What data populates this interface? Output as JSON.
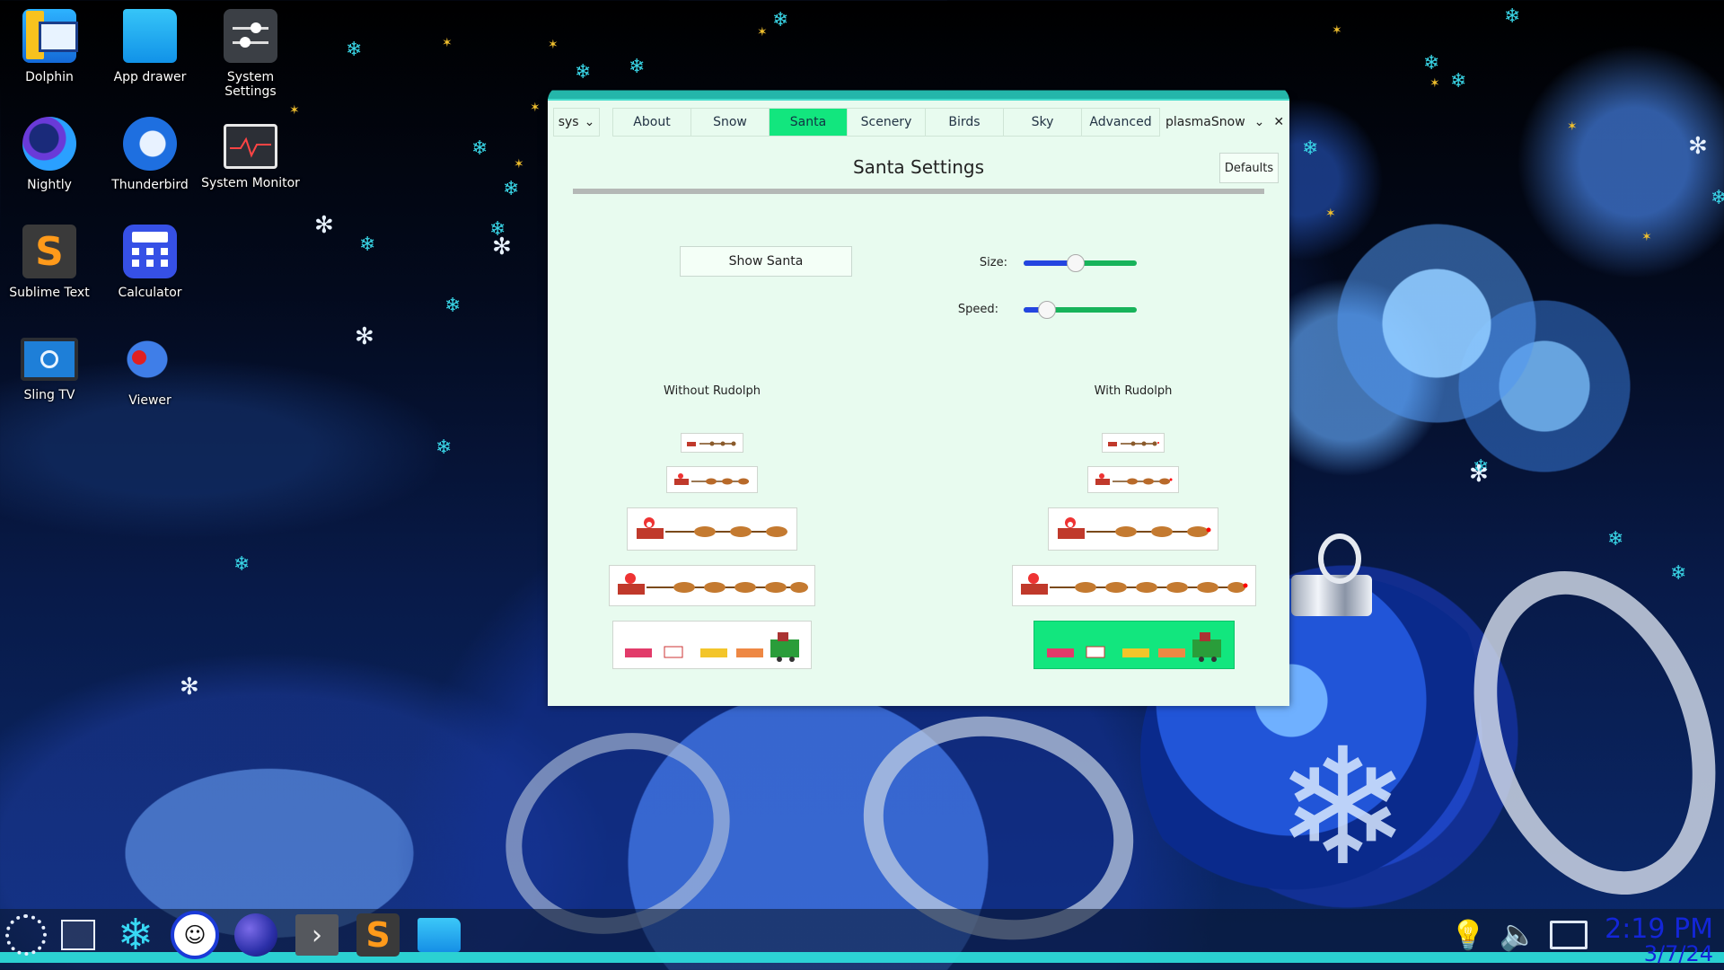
{
  "desktop": {
    "icons": [
      {
        "label": "Dolphin",
        "icon": "dolphin-icon"
      },
      {
        "label": "App drawer",
        "icon": "folder-icon"
      },
      {
        "label": "System Settings",
        "icon": "settings-icon"
      },
      {
        "label": "Nightly",
        "icon": "firefox-nightly-icon"
      },
      {
        "label": "Thunderbird",
        "icon": "thunderbird-icon"
      },
      {
        "label": "System Monitor",
        "icon": "system-monitor-icon"
      },
      {
        "label": "Sublime Text",
        "icon": "sublime-icon"
      },
      {
        "label": "Calculator",
        "icon": "calculator-icon"
      },
      {
        "label": "Sling TV",
        "icon": "tv-icon"
      },
      {
        "label": "Viewer",
        "icon": "fish-icon"
      }
    ]
  },
  "window": {
    "sys_label": "sys",
    "tabs": [
      {
        "label": "About"
      },
      {
        "label": "Snow"
      },
      {
        "label": "Santa",
        "active": true
      },
      {
        "label": "Scenery"
      },
      {
        "label": "Birds"
      },
      {
        "label": "Sky"
      },
      {
        "label": "Advanced"
      }
    ],
    "app_name": "plasmaSnow",
    "title": "Santa Settings",
    "defaults_label": "Defaults",
    "show_santa_label": "Show Santa",
    "size_label": "Size:",
    "speed_label": "Speed:",
    "size_value": 0.45,
    "speed_value": 0.2,
    "without_rudolph_label": "Without Rudolph",
    "with_rudolph_label": "With Rudolph",
    "selected_option": "with-rudolph-5",
    "accent": "#12e67e"
  },
  "taskbar": {
    "time": "2:19 PM",
    "date": "3/7/24",
    "clock_color": "#1326d8"
  }
}
